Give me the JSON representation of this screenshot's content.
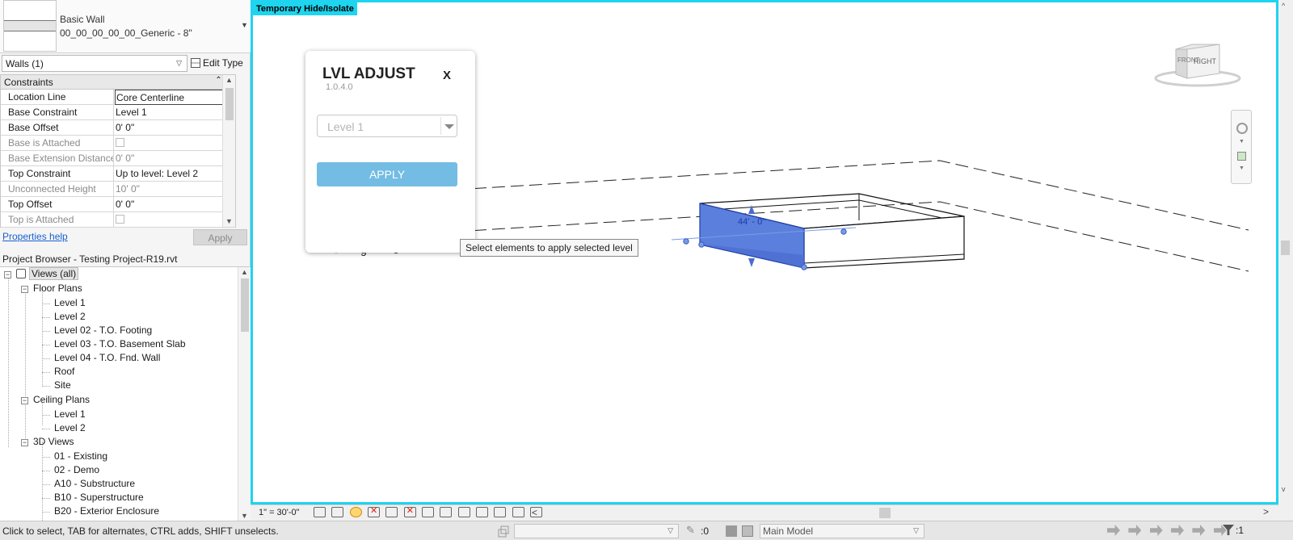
{
  "type_selector": {
    "family": "Basic Wall",
    "type_name": "00_00_00_00_00_Generic - 8\""
  },
  "category_filter": {
    "value": "Walls (1)",
    "edit_type_label": "Edit Type"
  },
  "properties": {
    "group_header": "Constraints",
    "rows": [
      {
        "name": "Location Line",
        "value": "Core Centerline",
        "enabled": true
      },
      {
        "name": "Base Constraint",
        "value": "Level 1",
        "enabled": true
      },
      {
        "name": "Base Offset",
        "value": "0'  0\"",
        "enabled": true
      },
      {
        "name": "Base is Attached",
        "value": "",
        "enabled": false
      },
      {
        "name": "Base Extension Distance",
        "value": "0'  0\"",
        "enabled": false
      },
      {
        "name": "Top Constraint",
        "value": "Up to level: Level 2",
        "enabled": true
      },
      {
        "name": "Unconnected Height",
        "value": "10'  0\"",
        "enabled": false
      },
      {
        "name": "Top Offset",
        "value": "0'  0\"",
        "enabled": true
      },
      {
        "name": "Top is Attached",
        "value": "",
        "enabled": false
      }
    ],
    "help_link": "Properties help",
    "apply_label": "Apply"
  },
  "project_browser": {
    "title": "Project Browser - Testing Project-R19.rvt",
    "root": "Views (all)",
    "groups": [
      {
        "label": "Floor Plans",
        "items": [
          "Level 1",
          "Level 2",
          "Level 02 - T.O. Footing",
          "Level 03 - T.O. Basement Slab",
          "Level 04 - T.O. Fnd. Wall",
          "Roof",
          "Site"
        ]
      },
      {
        "label": "Ceiling Plans",
        "items": [
          "Level 1",
          "Level 2"
        ]
      },
      {
        "label": "3D Views",
        "items": [
          "01 - Existing",
          "02 - Demo",
          "A10 - Substructure",
          "B10 - Superstructure",
          "B20 - Exterior Enclosure"
        ]
      }
    ]
  },
  "viewport": {
    "mode_banner": "Temporary Hide/Isolate",
    "dimension_label": "44' - 0\"",
    "viewcube_labels": [
      "FRONT",
      "RIGHT"
    ]
  },
  "lvl_adjust": {
    "title": "LVL ADJUST",
    "version": "1.0.4.0",
    "close_label": "X",
    "level_select": "Level 1",
    "apply_label": "APPLY",
    "tooltip": "Select elements to apply selected level"
  },
  "view_bar": {
    "scale": "1\" = 30'-0\""
  },
  "status_bar": {
    "message": "Click to select, TAB for alternates, CTRL adds, SHIFT unselects.",
    "workset": "",
    "editable_count": ":0",
    "design_option": "Main Model",
    "filter_count": ":1"
  },
  "colors": {
    "isolate_border": "#1ed4ee",
    "selected_wall": "#5b7fdc",
    "apply_button": "#73bce3",
    "link": "#1a5fd1"
  }
}
